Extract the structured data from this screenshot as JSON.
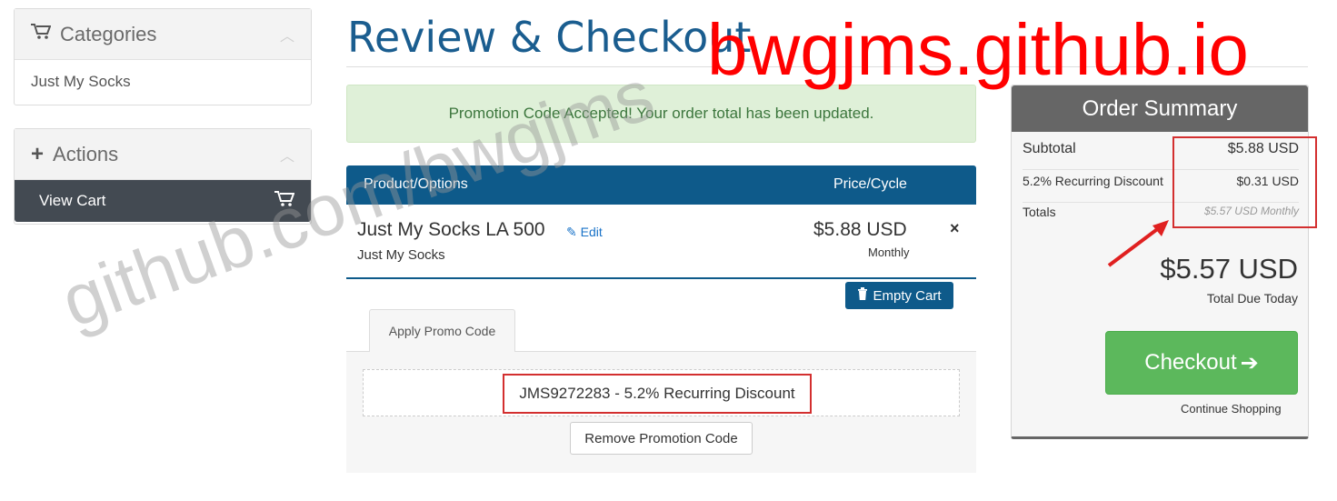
{
  "sidebar": {
    "categories": {
      "title": "Categories",
      "icon": "cart-icon",
      "items": [
        "Just My Socks"
      ]
    },
    "actions": {
      "title": "Actions",
      "icon": "plus-icon",
      "items": [
        {
          "label": "View Cart",
          "icon": "cart-icon"
        }
      ]
    }
  },
  "page": {
    "title": "Review & Checkout"
  },
  "alert": {
    "message": "Promotion Code Accepted! Your order total has been updated."
  },
  "cart": {
    "columns": {
      "product": "Product/Options",
      "price": "Price/Cycle"
    },
    "items": [
      {
        "name": "Just My Socks LA 500",
        "edit_label": "Edit",
        "group": "Just My Socks",
        "price": "$5.88 USD",
        "cycle": "Monthly",
        "remove_symbol": "×"
      }
    ],
    "empty_cart_label": "Empty Cart"
  },
  "promo": {
    "tab_label": "Apply Promo Code",
    "applied_code": "JMS9272283 - 5.2% Recurring Discount",
    "remove_label": "Remove Promotion Code"
  },
  "summary": {
    "title": "Order Summary",
    "rows": [
      {
        "label": "Subtotal",
        "value": "$5.88 USD"
      },
      {
        "label": "5.2% Recurring Discount",
        "value": "$0.31 USD"
      },
      {
        "label": "Totals",
        "value": "$5.57 USD Monthly"
      }
    ],
    "total": "$5.57 USD",
    "total_caption": "Total Due Today",
    "checkout_label": "Checkout",
    "continue_label": "Continue Shopping"
  },
  "watermarks": {
    "site": "bwgjms.github.io",
    "repo": "github.com/bwgjms"
  },
  "colors": {
    "brand_blue": "#0e5a8a",
    "success_green": "#5cb85c",
    "alert_green_bg": "#dff0d8",
    "annotation_red": "#d32f2f"
  }
}
